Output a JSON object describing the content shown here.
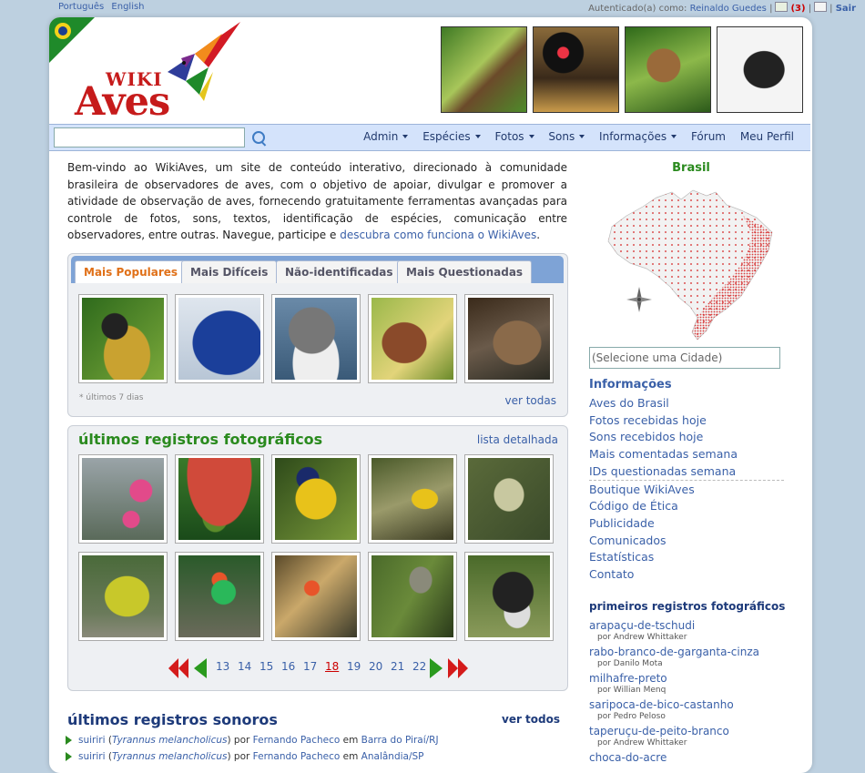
{
  "topbar": {
    "lang_pt": "Português",
    "lang_en": "English",
    "auth_label": "Autenticado(a) como:",
    "user": "Reinaldo Guedes",
    "count": "(3)",
    "logout": "Sair"
  },
  "logo": {
    "wiki": "WIKI",
    "aves": "Aves"
  },
  "nav": {
    "search_placeholder": "",
    "items": [
      "Admin",
      "Espécies",
      "Fotos",
      "Sons",
      "Informações",
      "Fórum",
      "Meu Perfil"
    ]
  },
  "intro": {
    "text": "Bem-vindo ao WikiAves, um site de conteúdo interativo, direcionado à comunidade brasileira de observadores de aves, com o objetivo de apoiar, divulgar e promover a atividade de observação de aves, fornecendo gratuitamente ferramentas avançadas para controle de fotos, sons, textos, identificação de espécies, comunicação entre observadores, entre outras. Navegue, participe e ",
    "link": "descubra como funciona o WikiAves",
    "end": "."
  },
  "tabs": {
    "items": [
      "Mais Populares",
      "Mais Difíceis",
      "Não-identificadas",
      "Mais Questionadas"
    ],
    "note": "* últimos 7 dias",
    "see_all": "ver todas"
  },
  "photo_records": {
    "title": "últimos registros fotográficos",
    "detail_link": "lista detalhada",
    "pages": [
      "13",
      "14",
      "15",
      "16",
      "17",
      "18",
      "19",
      "20",
      "21",
      "22"
    ],
    "current_page": "18"
  },
  "sounds": {
    "title": "últimos registros sonoros",
    "see_all": "ver todos",
    "rows": [
      {
        "name": "suiriri",
        "sci": "Tyrannus melancholicus",
        "by": "por",
        "author": "Fernando Pacheco",
        "em": "em",
        "place": "Barra do Piraí/RJ"
      },
      {
        "name": "suiriri",
        "sci": "Tyrannus melancholicus",
        "by": "por",
        "author": "Fernando Pacheco",
        "em": "em",
        "place": "Analândia/SP"
      }
    ]
  },
  "sidebar": {
    "map_title": "Brasil",
    "city_placeholder": "(Selecione uma Cidade)",
    "info_head": "Informações",
    "links": [
      "Aves do Brasil",
      "Fotos recebidas hoje",
      "Sons recebidos hoje",
      "Mais comentadas semana",
      "IDs questionadas semana",
      "Boutique WikiAves",
      "Código de Ética",
      "Publicidade",
      "Comunicados",
      "Estatísticas",
      "Contato"
    ],
    "first_records_head": "primeiros registros fotográficos",
    "first_records": [
      {
        "name": "arapaçu-de-tschudi",
        "by": "por Andrew Whittaker"
      },
      {
        "name": "rabo-branco-de-garganta-cinza",
        "by": "por Danilo Mota"
      },
      {
        "name": "milhafre-preto",
        "by": "por Willian Menq"
      },
      {
        "name": "saripoca-de-bico-castanho",
        "by": "por Pedro Peloso"
      },
      {
        "name": "taperuçu-de-peito-branco",
        "by": "por Andrew Whittaker"
      },
      {
        "name": "choca-do-acre",
        "by": ""
      }
    ]
  },
  "colors": {
    "accent": "#3a60a8",
    "green": "#2a8a1e",
    "orange": "#e07018",
    "red": "#c61b1b",
    "nav_bg": "#d4e3fb"
  }
}
